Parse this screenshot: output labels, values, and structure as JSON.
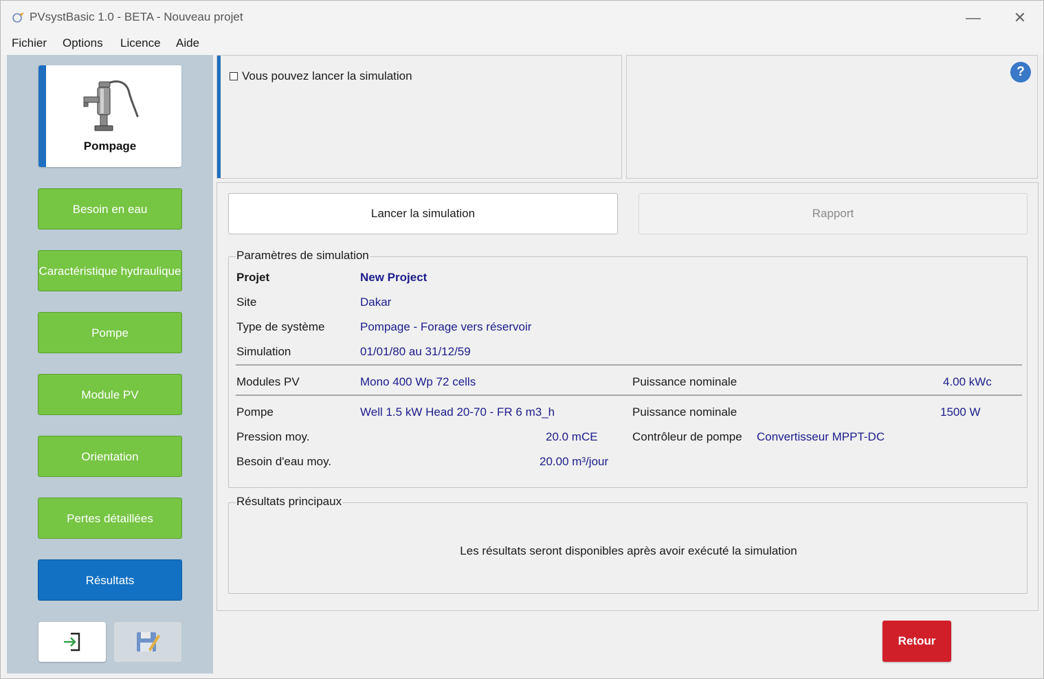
{
  "window": {
    "title": "PVsystBasic 1.0 - BETA - Nouveau projet",
    "minimize_glyph": "—",
    "close_glyph": "✕"
  },
  "menu": {
    "items": [
      "Fichier",
      "Options",
      "Licence",
      "Aide"
    ]
  },
  "sidebar": {
    "active_card": {
      "label": "Pompage",
      "icon": "water-pump-icon"
    },
    "buttons": [
      {
        "label": "Besoin en eau",
        "color": "#76c543"
      },
      {
        "label": "Caractéristique hydraulique",
        "color": "#76c543"
      },
      {
        "label": "Pompe",
        "color": "#76c543"
      },
      {
        "label": "Module PV",
        "color": "#76c543"
      },
      {
        "label": "Orientation",
        "color": "#76c543"
      },
      {
        "label": "Pertes détaillées",
        "color": "#76c543"
      },
      {
        "label": "Résultats",
        "color": "#1271c3"
      }
    ],
    "bottom_icons": [
      "exit-icon",
      "save-icon"
    ]
  },
  "info": {
    "message": "Vous pouvez lancer la simulation",
    "help_glyph": "?"
  },
  "actions": {
    "run_label": "Lancer la simulation",
    "report_label": "Rapport"
  },
  "params": {
    "title": "Paramètres de simulation",
    "project_label": "Projet",
    "project_value": "New Project",
    "site_label": "Site",
    "site_value": "Dakar",
    "system_type_label": "Type de système",
    "system_type_value": "Pompage - Forage vers réservoir",
    "simulation_label": "Simulation",
    "simulation_value": "01/01/80 au 31/12/59",
    "modules_label": "Modules PV",
    "modules_value": "Mono 400 Wp 72 cells",
    "modules_power_label": "Puissance nominale",
    "modules_power_value": "4.00 kWc",
    "pump_label": "Pompe",
    "pump_value": "Well 1.5 kW Head 20-70 - FR 6 m3_h",
    "pump_power_label": "Puissance nominale",
    "pump_power_value": "1500 W",
    "pressure_label": "Pression moy.",
    "pressure_value": "20.0 mCE",
    "controller_label": "Contrôleur de pompe",
    "controller_value": "Convertisseur MPPT-DC",
    "water_need_label": "Besoin d'eau moy.",
    "water_need_value": "20.00 m³/jour"
  },
  "results": {
    "title": "Résultats principaux",
    "message": "Les résultats seront disponibles après avoir exécuté la simulation"
  },
  "footer": {
    "back_label": "Retour",
    "back_color": "#d11f2a"
  }
}
